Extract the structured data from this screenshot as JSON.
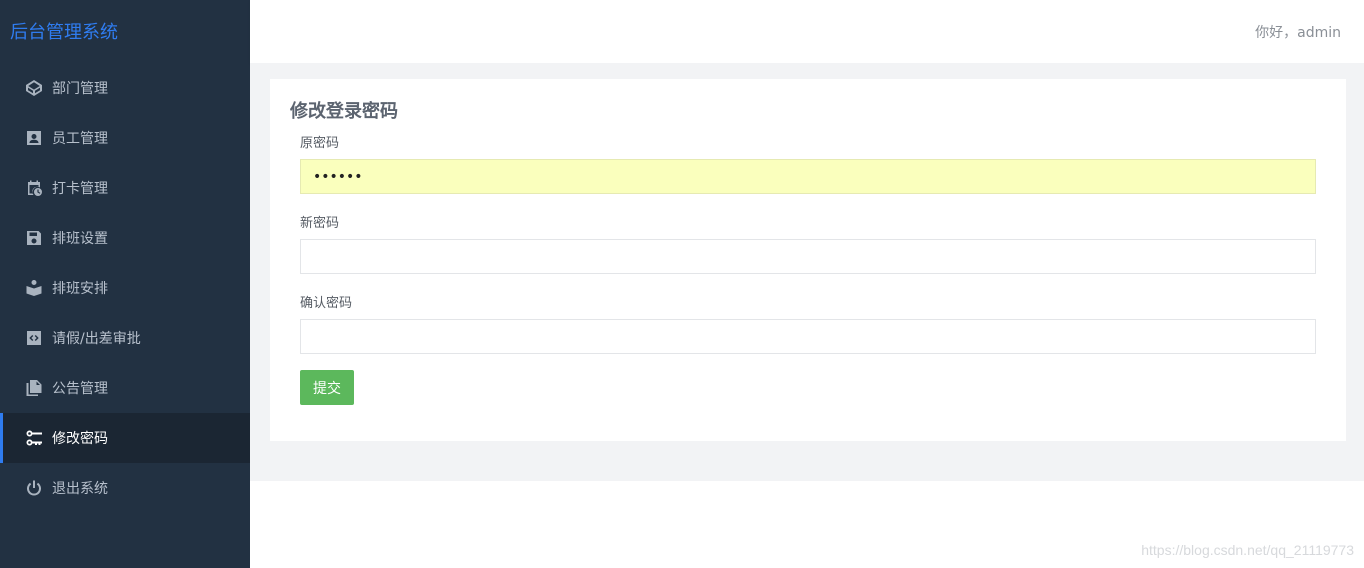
{
  "sidebar": {
    "brand": "后台管理系统",
    "items": [
      {
        "label": "部门管理",
        "icon": "cube-icon"
      },
      {
        "label": "员工管理",
        "icon": "user-card-icon"
      },
      {
        "label": "打卡管理",
        "icon": "calendar-clock-icon"
      },
      {
        "label": "排班设置",
        "icon": "save-icon"
      },
      {
        "label": "排班安排",
        "icon": "reader-icon"
      },
      {
        "label": "请假/出差审批",
        "icon": "code-box-icon"
      },
      {
        "label": "公告管理",
        "icon": "documents-icon"
      },
      {
        "label": "修改密码",
        "icon": "key-icon",
        "active": true
      },
      {
        "label": "退出系统",
        "icon": "power-icon"
      }
    ]
  },
  "header": {
    "greeting": "你好，admin"
  },
  "form": {
    "title": "修改登录密码",
    "old_password_label": "原密码",
    "old_password_value": "••••••",
    "new_password_label": "新密码",
    "new_password_value": "",
    "confirm_password_label": "确认密码",
    "confirm_password_value": "",
    "submit_label": "提交"
  },
  "watermark": "https://blog.csdn.net/qq_21119773",
  "colors": {
    "sidebar_bg": "#223142",
    "accent": "#2f7cf0",
    "submit": "#5cb85c",
    "autofill": "#faffbd"
  }
}
